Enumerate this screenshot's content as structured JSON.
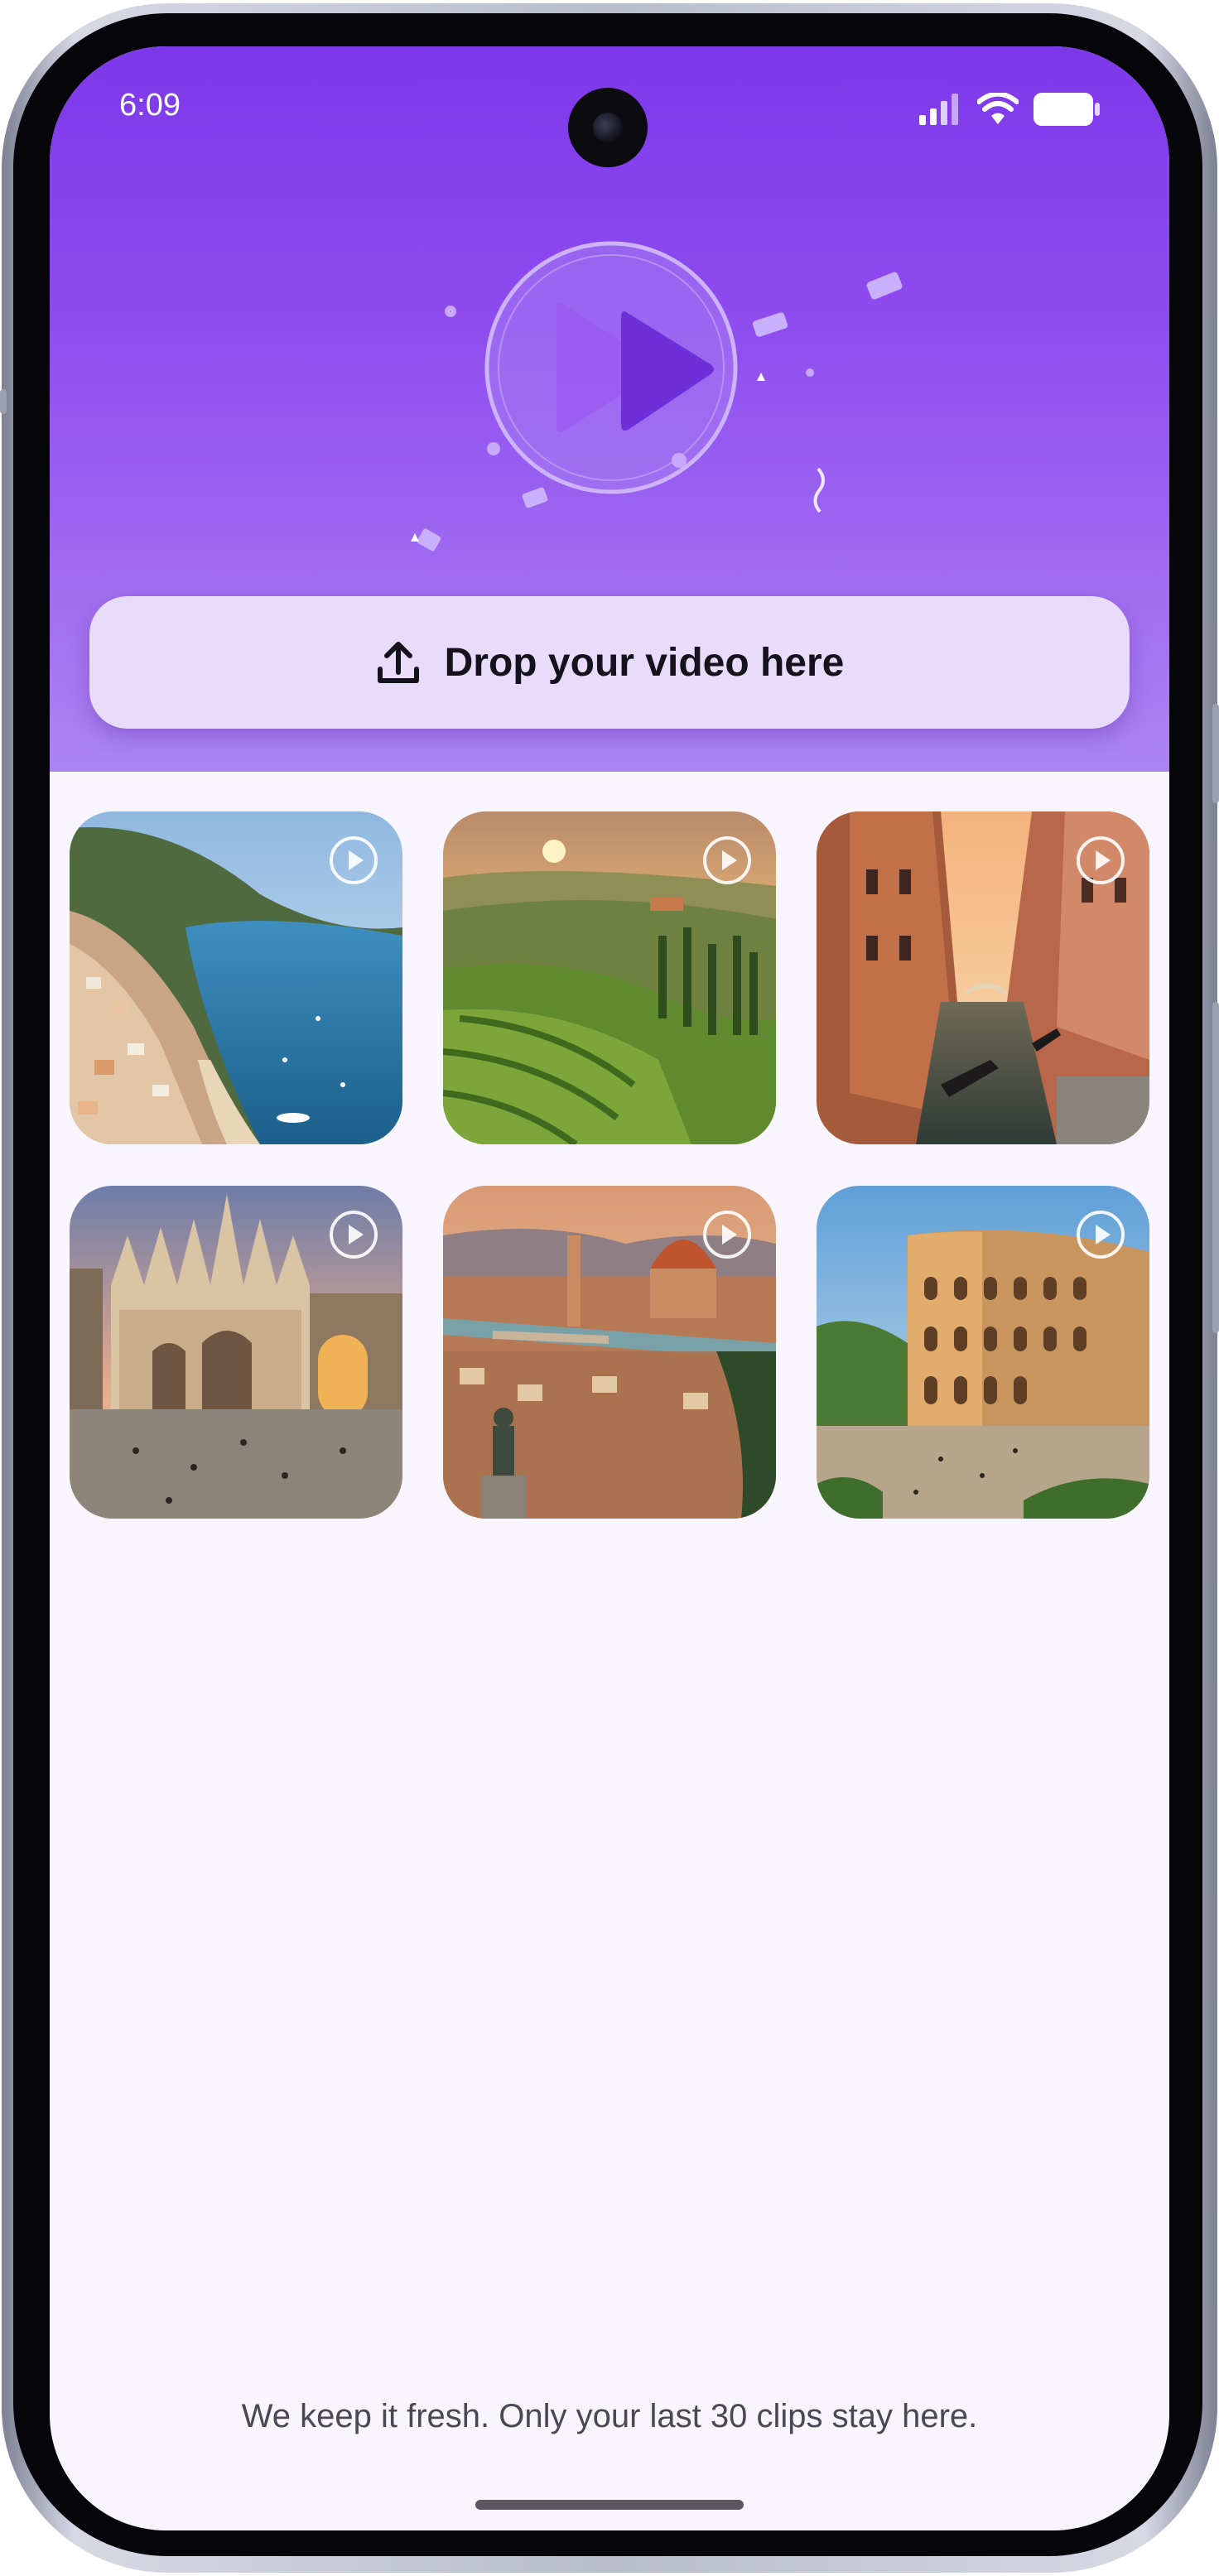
{
  "status_bar": {
    "time": "6:09",
    "icons": [
      "signal-icon",
      "wifi-icon",
      "battery-icon"
    ]
  },
  "hero": {
    "logo_icon": "play-logo-icon",
    "upload_icon": "upload-icon",
    "drop_label": "Drop your video here"
  },
  "gallery": {
    "items": [
      {
        "scene": "coastal-village-sea",
        "icon": "play-circle-icon"
      },
      {
        "scene": "vineyard-sunset-hills",
        "icon": "play-circle-icon"
      },
      {
        "scene": "canal-with-gondolas",
        "icon": "play-circle-icon"
      },
      {
        "scene": "gothic-cathedral-square",
        "icon": "play-circle-icon"
      },
      {
        "scene": "city-with-dome-and-statue",
        "icon": "play-circle-icon"
      },
      {
        "scene": "ancient-amphitheater",
        "icon": "play-circle-icon"
      }
    ]
  },
  "footer": {
    "note": "We keep it fresh. Only your last 30 clips stay here."
  },
  "colors": {
    "hero_top": "#7d38ea",
    "hero_bottom": "#ad83f2",
    "drop_button_bg": "#e8dcfa",
    "screen_bg": "#f8f5fd"
  }
}
